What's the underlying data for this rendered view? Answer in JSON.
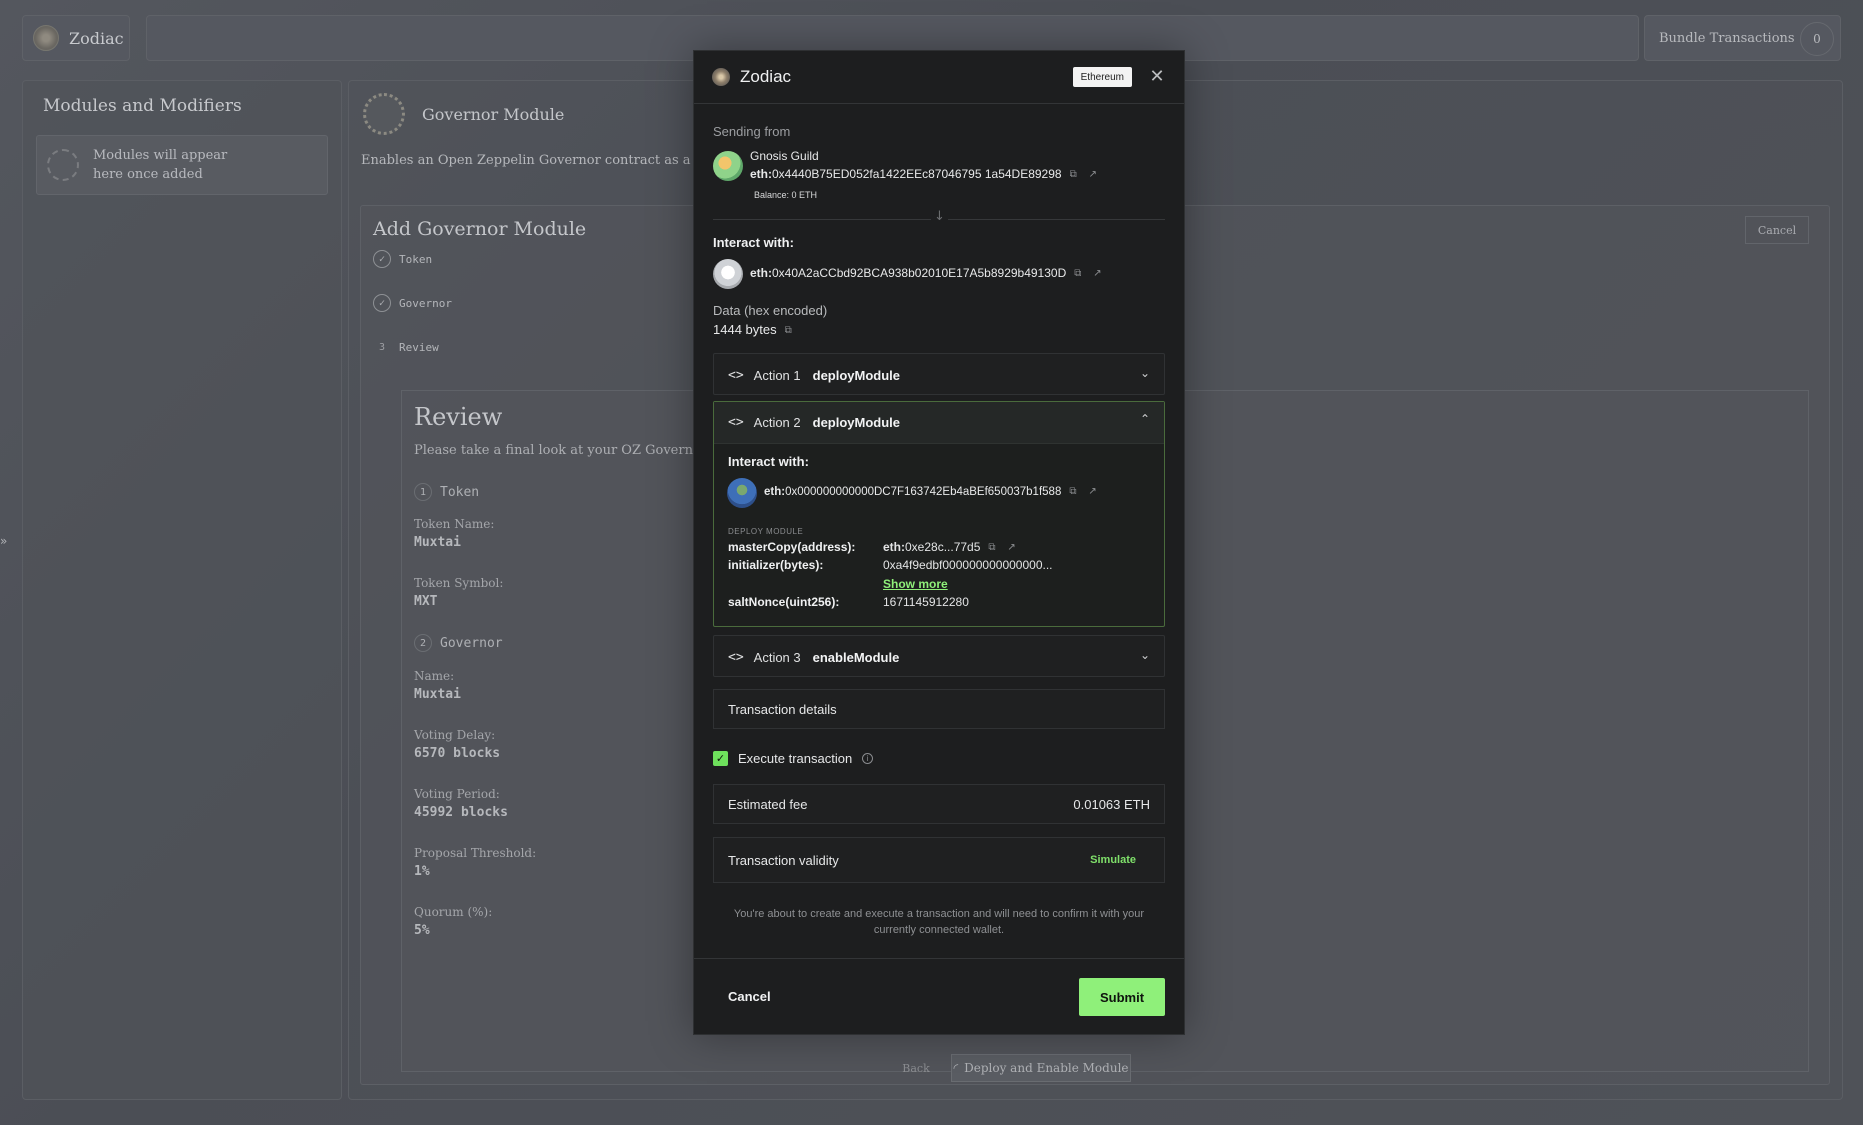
{
  "app": {
    "logo_text": "Zodiac",
    "bundle_label": "Bundle Transactions",
    "bundle_count": "0"
  },
  "sidebar": {
    "title": "Modules and Modifiers",
    "empty_text": "Modules will appear here once added"
  },
  "main": {
    "module_title": "Governor Module",
    "module_desc": "Enables an Open Zeppelin Governor contract as a module",
    "add_title": "Add Governor Module",
    "cancel_label": "Cancel",
    "steps": [
      {
        "label": "Token",
        "state": "done"
      },
      {
        "label": "Governor",
        "state": "done"
      },
      {
        "label": "Review",
        "state": "current",
        "num": "3"
      }
    ],
    "review": {
      "title": "Review",
      "desc": "Please take a final look at your OZ Governor Mo",
      "sections": [
        {
          "num": "1",
          "title": "Token"
        },
        {
          "num": "2",
          "title": "Governor"
        }
      ],
      "fields": [
        {
          "label": "Token Name:",
          "value": "Muxtai"
        },
        {
          "label": "Token Symbol:",
          "value": "MXT"
        },
        {
          "label": "Name:",
          "value": "Muxtai"
        },
        {
          "label": "Voting Delay:",
          "value": "6570 blocks"
        },
        {
          "label": "Voting Period:",
          "value": "45992 blocks"
        },
        {
          "label": "Proposal Threshold:",
          "value": "1%"
        },
        {
          "label": "Quorum (%):",
          "value": "5%"
        }
      ]
    },
    "back_label": "Back",
    "deploy_label": "Deploy and Enable Module"
  },
  "modal": {
    "title": "Zodiac",
    "network": "Ethereum",
    "sending_from_label": "Sending from",
    "sender_name": "Gnosis Guild",
    "sender_prefix": "eth:",
    "sender_address": "0x4440B75ED052fa1422EEc87046795 1a54DE89298",
    "sender_balance": "Balance: 0 ETH",
    "interact_label": "Interact with:",
    "target_prefix": "eth:",
    "target_address": "0x40A2aCCbd92BCA938b02010E17A5b8929b49130D",
    "data_label": "Data (hex encoded)",
    "data_size": "1444 bytes",
    "actions": [
      {
        "num": "Action 1",
        "fn": "deployModule",
        "open": false
      },
      {
        "num": "Action 2",
        "fn": "deployModule",
        "open": true
      },
      {
        "num": "Action 3",
        "fn": "enableModule",
        "open": false
      }
    ],
    "action2": {
      "interact_label": "Interact with:",
      "prefix": "eth:",
      "address": "0x000000000000DC7F163742Eb4aBEf650037b1f588",
      "section_label": "DEPLOY MODULE",
      "params": [
        {
          "name": "masterCopy(address):",
          "prefix": "eth:",
          "value": "0xe28c...77d5"
        },
        {
          "name": "initializer(bytes):",
          "value": "0xa4f9edbf000000000000000...",
          "more": "Show more"
        },
        {
          "name": "saltNonce(uint256):",
          "value": "1671145912280"
        }
      ]
    },
    "tx_details_label": "Transaction details",
    "execute_label": "Execute transaction",
    "fee_label": "Estimated fee",
    "fee_value": "0.01063 ETH",
    "validity_label": "Transaction validity",
    "simulate_label": "Simulate",
    "note": "You're about to create and execute a transaction and will need to confirm it with your currently connected wallet.",
    "cancel_label": "Cancel",
    "submit_label": "Submit"
  },
  "colors": {
    "accent": "#8ff07a",
    "modal_bg": "#1d1e1f",
    "overlay_bg": "#4a4d53"
  },
  "icons": [
    "zodiac-logo-icon",
    "close-icon",
    "copy-icon",
    "external-link-icon",
    "code-icon",
    "chevron-down-icon",
    "chevron-up-icon",
    "info-icon",
    "check-icon",
    "arrow-down-icon"
  ]
}
